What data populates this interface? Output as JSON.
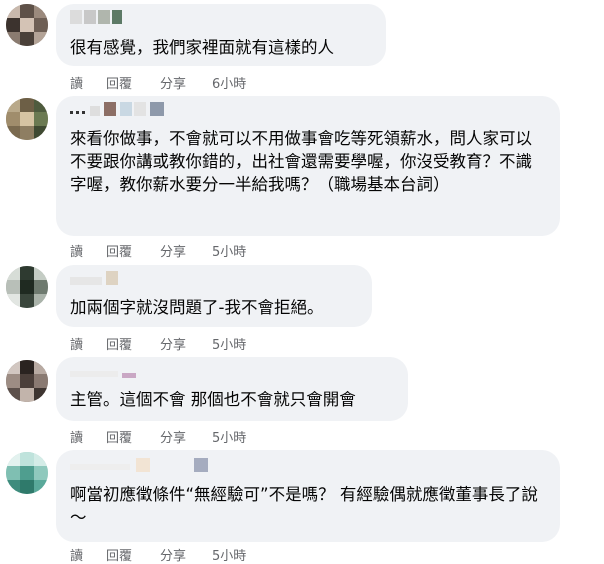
{
  "comments": [
    {
      "text": "很有感覺，我們家裡面就有這樣的人",
      "actions": {
        "read": "讀",
        "reply": "回覆",
        "share": "分享",
        "time": "6小時"
      }
    },
    {
      "text": "來看你做事，不會就可以不用做事會吃等死領薪水，問人家可以不要跟你講或教你錯的，出社會還需要學喔，你沒受教育？不識字喔，教你薪水要分一半給我嗎？（職場基本台詞）",
      "actions": {
        "read": "讀",
        "reply": "回覆",
        "share": "分享",
        "time": "5小時"
      }
    },
    {
      "text": "加兩個字就沒問題了-我不會拒絕。",
      "actions": {
        "read": "讀",
        "reply": "回覆",
        "share": "分享",
        "time": "5小時"
      }
    },
    {
      "text": "主管。這個不會 那個也不會就只會開會",
      "actions": {
        "read": "讀",
        "reply": "回覆",
        "share": "分享",
        "time": "5小時"
      }
    },
    {
      "text": "啊當初應徵條件“無經驗可”不是嗎？ 有經驗偶就應徵董事長了說～",
      "actions": {
        "read": "讀",
        "reply": "回覆",
        "share": "分享",
        "time": "5小時"
      }
    }
  ],
  "colors": {
    "bubble": "#f0f2f5",
    "text": "#050505",
    "meta": "#65676b"
  }
}
